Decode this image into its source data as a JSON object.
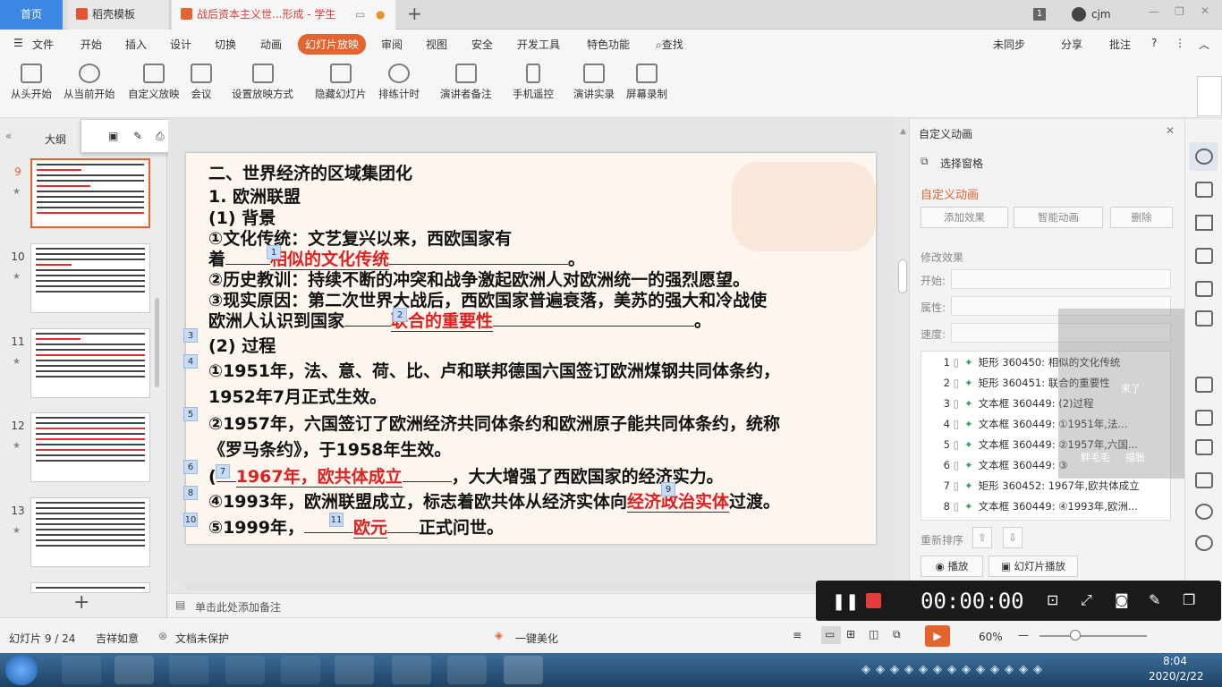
{
  "tabs": {
    "home": "首页",
    "template": "稻壳模板",
    "doc": "战后资本主义世...形成 - 学生"
  },
  "window": {
    "page_badge": "1",
    "user": "cjm"
  },
  "menu": {
    "file": "文件",
    "items": [
      "开始",
      "插入",
      "设计",
      "切换",
      "动画",
      "幻灯片放映",
      "审阅",
      "视图",
      "安全",
      "开发工具",
      "特色功能"
    ],
    "active": "幻灯片放映",
    "search": "查找",
    "sync": "未同步",
    "share": "分享",
    "comment": "批注"
  },
  "ribbon": [
    "从头开始",
    "从当前开始",
    "自定义放映",
    "会议",
    "设置放映方式",
    "隐藏幻灯片",
    "排练计时",
    "演讲者备注",
    "手机遥控",
    "演讲实录",
    "屏幕录制"
  ],
  "left": {
    "outline_tab": "大纲",
    "thumbnails": [
      "9",
      "10",
      "11",
      "12",
      "13"
    ],
    "selected": "9"
  },
  "slide": {
    "l1": "二、世界经济的区域集团化",
    "l2": "1. 欧洲联盟",
    "l3": "(1) 背景",
    "l4": "①文化传统：文艺复兴以来，西欧国家有",
    "l5a": "着",
    "l5b": "相似的文化传统",
    "l5c": "。",
    "l6": "②历史教训：持续不断的冲突和战争激起欧洲人对欧洲统一的强烈愿望。",
    "l7": "③现实原因：第二次世界大战后，西欧国家普遍衰落，美苏的强大和冷战使",
    "l8a": "欧洲人认识到国家",
    "l8b": "联合的重要性",
    "l8c": "。",
    "l9": "(2) 过程",
    "l10": "①1951年，法、意、荷、比、卢和联邦德国六国签订欧洲煤钢共同体条约，",
    "l11": "1952年7月正式生效。",
    "l12": "②1957年，六国签订了欧洲经济共同体条约和欧洲原子能共同体条约，统称",
    "l13": "《罗马条约》，于1958年生效。",
    "l14a": "(",
    "l14b": "1967年，欧共体成立",
    "l14c": "，大大增强了西欧国家的经济实力。",
    "l15a": "④1993年，欧洲联盟成立，标志着欧共体从经济实体向",
    "l15b": "经济政治实体",
    "l15c": "过渡。",
    "l16a": "⑤1999年，",
    "l16b": "欧元",
    "l16c": "正式问世。",
    "tags": [
      "1",
      "2",
      "3",
      "4",
      "5",
      "6",
      "7",
      "8",
      "9",
      "10",
      "11"
    ]
  },
  "notes": "单击此处添加备注",
  "panel": {
    "title": "自定义动画",
    "select_pane": "选择窗格",
    "section": "自定义动画",
    "add_effect": "添加效果",
    "smart_anim": "智能动画",
    "delete": "删除",
    "modify": "修改效果",
    "start": "开始:",
    "property": "属性:",
    "speed": "速度:",
    "list": [
      {
        "n": "1",
        "t": "矩形 360450: 相似的文化传统"
      },
      {
        "n": "2",
        "t": "矩形 360451: 联合的重要性"
      },
      {
        "n": "3",
        "t": "文本框 360449: (2)过程"
      },
      {
        "n": "4",
        "t": "文本框 360449: ①1951年,法..."
      },
      {
        "n": "5",
        "t": "文本框 360449: ②1957年,六国..."
      },
      {
        "n": "6",
        "t": "文本框 360449: ③"
      },
      {
        "n": "7",
        "t": "矩形 360452: 1967年,欧共体成立"
      },
      {
        "n": "8",
        "t": "文本框 360449: ④1993年,欧洲..."
      }
    ],
    "reorder": "重新排序",
    "play": "播放",
    "slideshow": "幻灯片播放"
  },
  "ghost": {
    "a": "1",
    "b": "来了",
    "c": "胖毛毛",
    "d": "描胀"
  },
  "recorder": {
    "time": "00:00:00"
  },
  "status": {
    "slide": "幻灯片 9 / 24",
    "theme": "吉祥如意",
    "protect": "文档未保护",
    "beautify": "一键美化",
    "zoom": "60%"
  },
  "clock": {
    "time": "8:04",
    "date": "2020/2/22"
  }
}
